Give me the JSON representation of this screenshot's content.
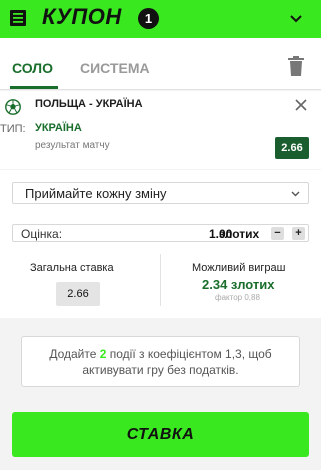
{
  "header": {
    "title": "КУПОН",
    "count": "1"
  },
  "tabs": [
    {
      "label": "СОЛО",
      "active": true
    },
    {
      "label": "СИСТЕМА",
      "active": false
    }
  ],
  "bet": {
    "match": "ПОЛЬЩА - УКРАЇНА",
    "type_label": "ТИП:",
    "pick": "УКРАЇНА",
    "market": "результат матчу",
    "odd": "2.66"
  },
  "odds_change": {
    "selected": "Приймайте кожну зміну"
  },
  "stake": {
    "label": "Оцінка:",
    "value": "1.00",
    "currency": "злотих",
    "minus": "−",
    "plus": "+"
  },
  "summary": {
    "total_label": "Загальна ставка",
    "total_value": "2.66",
    "win_label": "Можливий виграш",
    "win_value": "2.34 злотих",
    "factor": "фактор 0,88"
  },
  "promo": {
    "before": "Додайте ",
    "highlight": "2",
    "after": " події з коефіцієнтом 1,3, щоб активувати гру без податків."
  },
  "cta": {
    "label": "СТАВКА"
  },
  "colors": {
    "brand_green": "#3ae81f",
    "dark_green": "#1a6e2c",
    "odd_badge": "#1a5e30"
  }
}
